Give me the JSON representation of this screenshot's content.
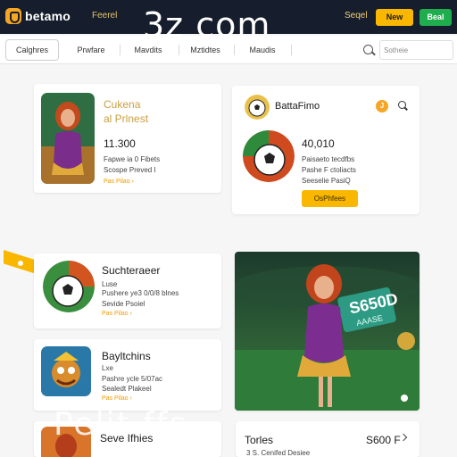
{
  "header": {
    "brand": "betamo",
    "nav_link": "Feerel",
    "watermark": "3z com",
    "signin_label": "Seqel",
    "new_label": "New",
    "beat_label": "Beal"
  },
  "subnav": {
    "tabs": [
      "Calghres",
      "Prwfare",
      "Mavdits",
      "Mztidtes",
      "Maudis"
    ],
    "search_placeholder": "Sotheie"
  },
  "cards": {
    "calena": {
      "title_line1": "Cukena",
      "title_line2": "al Prlnest",
      "amount": "11.300",
      "line1": "Fapwe ia 0 Fibets",
      "line2": "Scospe Preved I",
      "link": "Pas Pilao ›"
    },
    "batta": {
      "title": "BattaFimo",
      "coin": "J",
      "amount": "40,010",
      "line1": "Paisaeto tecdfbs",
      "line2": "Pashe F ctoliacts",
      "line3": "Seeselie PasiQ",
      "button": "OsPhfees"
    },
    "such": {
      "title": "Suchteraeer",
      "line1": "Luse",
      "line2": "Pushere ye3 0/0/8 blnes",
      "line3": "Sevide Psoiel",
      "link": "Pas Pilao ›"
    },
    "bay": {
      "title": "Bayltchins",
      "line1": "Lxe",
      "line2": "Pashre ycle 5/07ac",
      "line3": "Sealedt Plakeel",
      "link": "Pas Pilao ›"
    },
    "seve": {
      "title": "Seve Ifhies"
    },
    "tories": {
      "title": "Torles",
      "subtitle": "3 S. Cenifed Desiee",
      "amount": "S600 F"
    },
    "promo": {
      "sign_amount": "S650D",
      "sign_sub": "AAASE"
    }
  },
  "footer_watermark": "Pelit ffs",
  "colors": {
    "header_bg": "#161d2c",
    "accent_yellow": "#f9b700",
    "accent_green": "#1fad4e",
    "accent_orange": "#f29a00"
  }
}
